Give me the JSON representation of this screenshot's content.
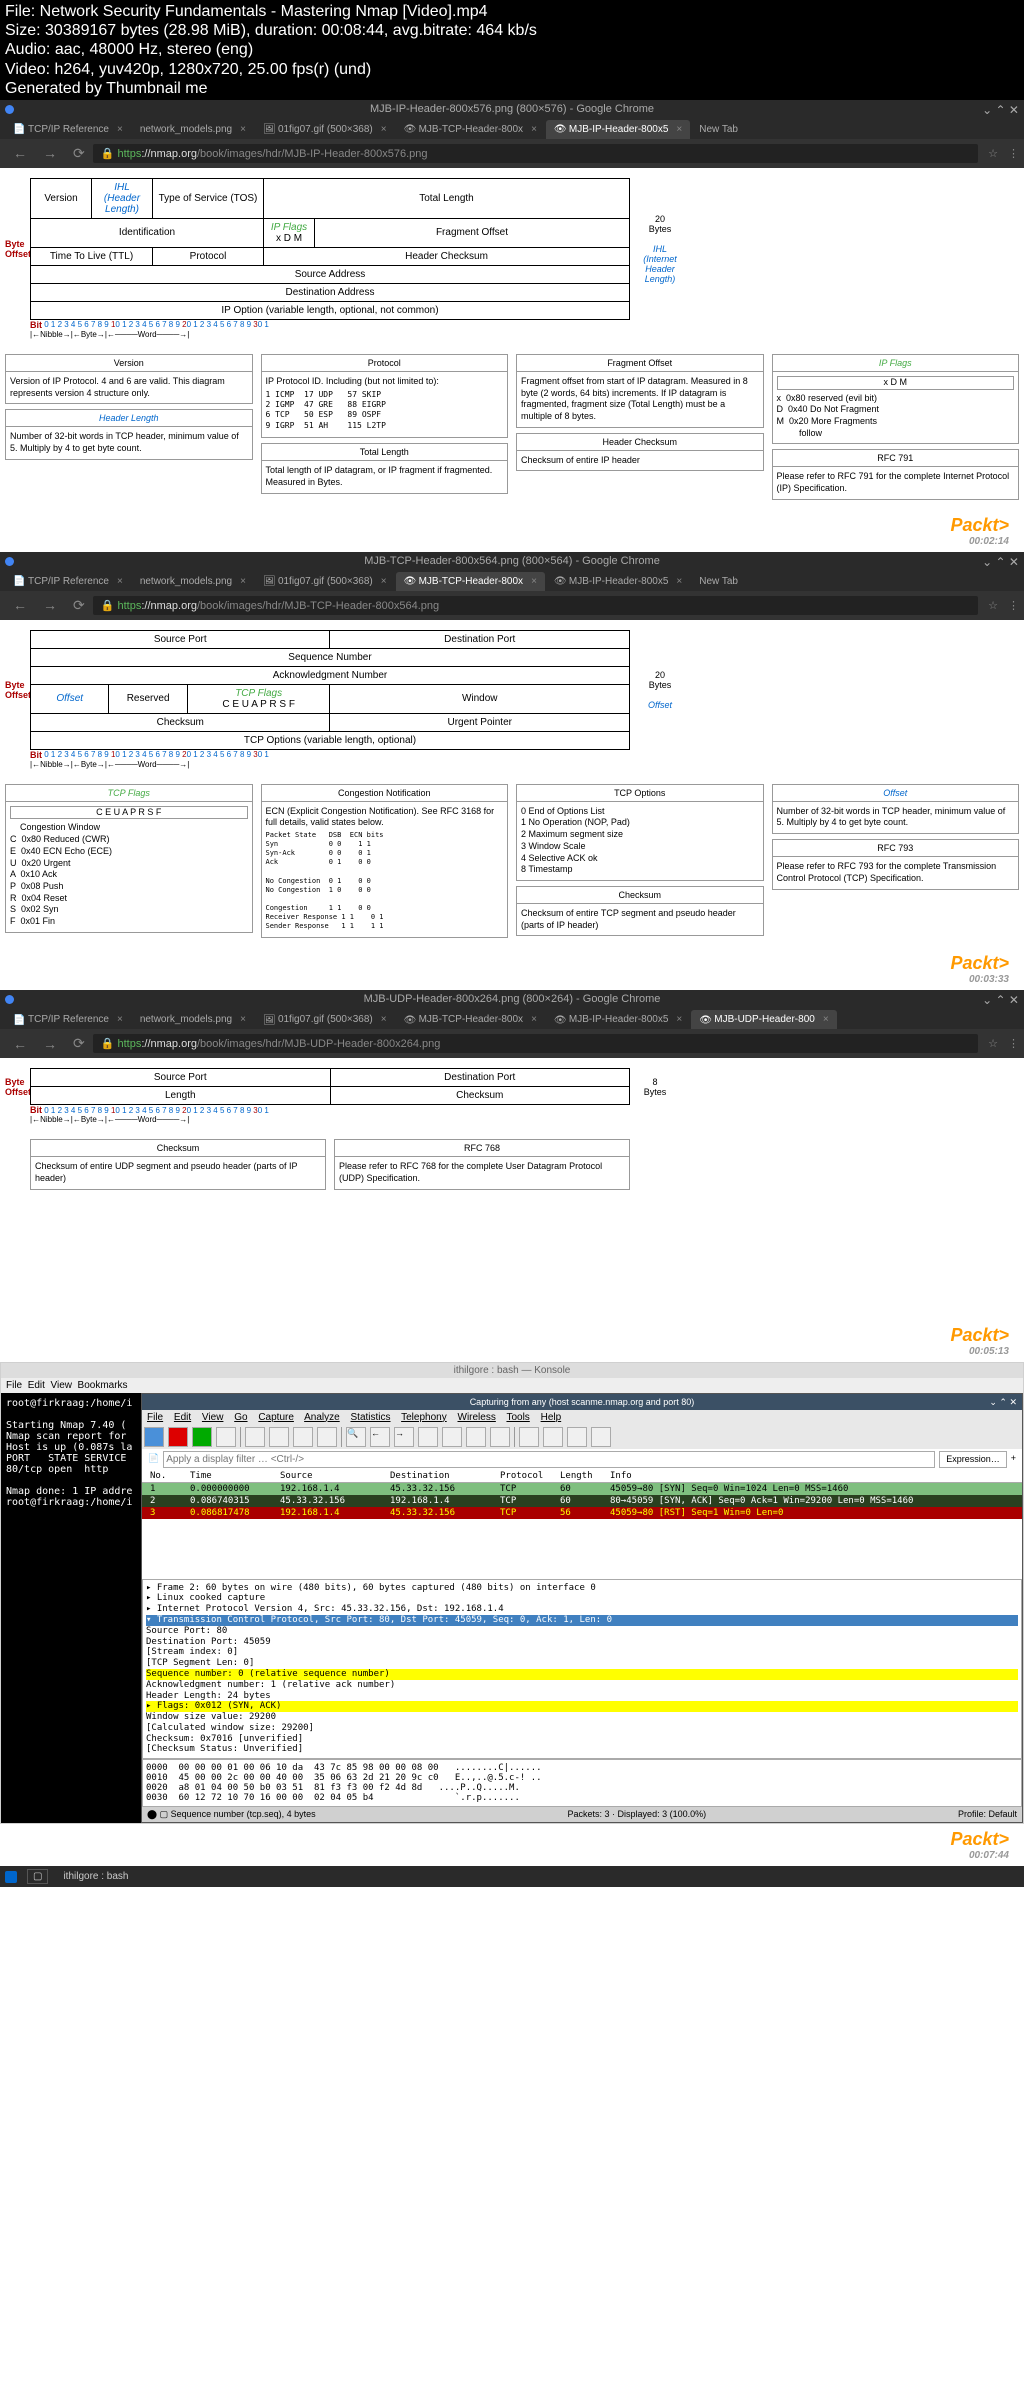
{
  "video_info": {
    "file": "File: Network Security Fundamentals - Mastering Nmap [Video].mp4",
    "size": "Size: 30389167 bytes (28.98 MiB), duration: 00:08:44, avg.bitrate: 464 kb/s",
    "audio": "Audio: aac, 48000 Hz, stereo (eng)",
    "video": "Video: h264, yuv420p, 1280x720, 25.00 fps(r) (und)",
    "generated": "Generated by Thumbnail me"
  },
  "screen1": {
    "title": "MJB-IP-Header-800x576.png (800×576) - Google Chrome",
    "tabs": [
      "TCP/IP Reference",
      "network_models.png",
      "01fig07.gif (500×368)",
      "MJB-TCP-Header-800x",
      "MJB-IP-Header-800x5",
      "New Tab"
    ],
    "active_tab": 4,
    "url_prefix": "https",
    "url_host": "://nmap.org",
    "url_path": "/book/images/hdr/MJB-IP-Header-800x576.png",
    "byte_offset": "Byte\nOffset",
    "row0": {
      "version": "Version",
      "ihl": "IHL (Header Length)",
      "tos": "Type of Service (TOS)",
      "total": "Total Length"
    },
    "row4": {
      "id": "Identification",
      "flags": "IP Flags",
      "flags_bits": "x  D  M",
      "frag": "Fragment Offset"
    },
    "row8": {
      "ttl": "Time To Live (TTL)",
      "proto": "Protocol",
      "chk": "Header Checksum"
    },
    "row12": "Source Address",
    "row16": "Destination Address",
    "row20": "IP Option (variable length, optional, not common)",
    "side_20bytes": "20\nBytes",
    "side_ihl": "IHL\n(Internet\nHeader\nLength)",
    "bit_label": "Bit",
    "nibble": "Nibble",
    "byte": "Byte",
    "word": "Word",
    "boxes": {
      "version": {
        "t": "Version",
        "b": "Version of IP Protocol.  4 and 6 are valid.  This diagram represents version 4 structure only."
      },
      "hlen": {
        "t": "Header Length",
        "b": "Number of 32-bit words in TCP header, minimum value of 5.  Multiply by 4 to get byte count."
      },
      "protocol": {
        "t": "Protocol",
        "b": "IP Protocol ID.  Including (but not limited to):"
      },
      "protocol_table": "1 ICMP  17 UDP   57 SKIP\n2 IGMP  47 GRE   88 EIGRP\n6 TCP   50 ESP   89 OSPF\n9 IGRP  51 AH    115 L2TP",
      "tlen": {
        "t": "Total Length",
        "b": "Total length of IP datagram, or IP fragment if fragmented. Measured in Bytes."
      },
      "frag": {
        "t": "Fragment Offset",
        "b": "Fragment offset from start of IP datagram.  Measured in 8 byte (2 words, 64 bits) increments.  If IP datagram is fragmented, fragment size (Total Length) must be a multiple of 8 bytes."
      },
      "hchk": {
        "t": "Header Checksum",
        "b": "Checksum of entire IP header"
      },
      "ipflags": {
        "t": "IP Flags",
        "bits": "x  D  M",
        "b": "x  0x80 reserved (evil bit)\nD  0x40 Do Not Fragment\nM  0x20 More Fragments\n         follow"
      },
      "rfc": {
        "t": "RFC 791",
        "b": "Please refer to RFC 791 for the complete Internet Protocol (IP) Specification."
      }
    },
    "packt": "Packt>",
    "time": "00:02:14"
  },
  "screen2": {
    "title": "MJB-TCP-Header-800x564.png (800×564) - Google Chrome",
    "tabs": [
      "TCP/IP Reference",
      "network_models.png",
      "01fig07.gif (500×368)",
      "MJB-TCP-Header-800x",
      "MJB-IP-Header-800x5",
      "New Tab"
    ],
    "active_tab": 3,
    "url_path": "/book/images/hdr/MJB-TCP-Header-800x564.png",
    "row0": {
      "src": "Source Port",
      "dst": "Destination Port"
    },
    "row4": "Sequence Number",
    "row8": "Acknowledgment Number",
    "row12": {
      "offset": "Offset",
      "res": "Reserved",
      "flags": "TCP Flags",
      "flags_bits": "C E U A P R S F",
      "win": "Window"
    },
    "row16": {
      "chk": "Checksum",
      "urg": "Urgent Pointer"
    },
    "row20": "TCP Options (variable length, optional)",
    "side_offset": "Offset",
    "boxes": {
      "tcpflags": {
        "t": "TCP Flags",
        "bits": "C E U A P R S F",
        "b": "    Congestion Window\nC  0x80 Reduced (CWR)\nE  0x40 ECN Echo (ECE)\nU  0x20 Urgent\nA  0x10 Ack\nP  0x08 Push\nR  0x04 Reset\nS  0x02 Syn\nF  0x01 Fin"
      },
      "congestion": {
        "t": "Congestion Notification",
        "b": "ECN (Explicit Congestion Notification).  See RFC 3168 for full details, valid states below."
      },
      "congestion_table": "Packet State   DSB  ECN bits\nSyn            0 0    1 1\nSyn-Ack        0 0    0 1\nAck            0 1    0 0\n\nNo Congestion  0 1    0 0\nNo Congestion  1 0    0 0\n\nCongestion     1 1    0 0\nReceiver Response 1 1    0 1\nSender Response   1 1    1 1",
      "tcpopt": {
        "t": "TCP Options",
        "b": "0 End of Options List\n1 No Operation (NOP, Pad)\n2 Maximum segment size\n3 Window Scale\n4 Selective ACK ok\n8 Timestamp"
      },
      "chk": {
        "t": "Checksum",
        "b": "Checksum of entire TCP segment and pseudo header (parts of IP header)"
      },
      "offset": {
        "t": "Offset",
        "b": "Number of 32-bit words in TCP header, minimum value of 5.  Multiply by 4 to get byte count."
      },
      "rfc": {
        "t": "RFC 793",
        "b": "Please refer to RFC 793 for the complete Transmission Control Protocol (TCP) Specification."
      }
    },
    "time": "00:03:33"
  },
  "screen3": {
    "title": "MJB-UDP-Header-800x264.png (800×264) - Google Chrome",
    "tabs": [
      "TCP/IP Reference",
      "network_models.png",
      "01fig07.gif (500×368)",
      "MJB-TCP-Header-800x",
      "MJB-IP-Header-800x5",
      "MJB-UDP-Header-800"
    ],
    "active_tab": 5,
    "url_path": "/book/images/hdr/MJB-UDP-Header-800x264.png",
    "row0": {
      "src": "Source Port",
      "dst": "Destination Port"
    },
    "row4": {
      "len": "Length",
      "chk": "Checksum"
    },
    "side": "8\nBytes",
    "boxes": {
      "chk": {
        "t": "Checksum",
        "b": "Checksum of entire UDP segment and pseudo header (parts of IP header)"
      },
      "rfc": {
        "t": "RFC 768",
        "b": "Please refer to RFC 768 for the complete User Datagram Protocol (UDP) Specification."
      }
    },
    "time": "00:05:13"
  },
  "screen4": {
    "konsole_title": "ithilgore : bash — Konsole",
    "konsole_menu": [
      "File",
      "Edit",
      "View",
      "Bookmarks"
    ],
    "terminal": "root@firkraag:/home/i\n\nStarting Nmap 7.40 (\nNmap scan report for\nHost is up (0.087s la\nPORT   STATE SERVICE\n80/tcp open  http\n\nNmap done: 1 IP addre\nroot@firkraag:/home/i",
    "ws_title": "Capturing from any (host scanme.nmap.org and port 80)",
    "ws_menu": [
      "File",
      "Edit",
      "View",
      "Go",
      "Capture",
      "Analyze",
      "Statistics",
      "Telephony",
      "Wireless",
      "Tools",
      "Help"
    ],
    "ws_filter_placeholder": "Apply a display filter … <Ctrl-/>",
    "ws_expression": "Expression…",
    "ws_headers": [
      "No.",
      "Time",
      "Source",
      "Destination",
      "Protocol",
      "Length",
      "Info"
    ],
    "ws_rows": [
      {
        "no": "1",
        "time": "0.000000000",
        "src": "192.168.1.4",
        "dst": "45.33.32.156",
        "proto": "TCP",
        "len": "60",
        "info": "45059→80 [SYN] Seq=0 Win=1024 Len=0 MSS=1460"
      },
      {
        "no": "2",
        "time": "0.086740315",
        "src": "45.33.32.156",
        "dst": "192.168.1.4",
        "proto": "TCP",
        "len": "60",
        "info": "80→45059 [SYN, ACK] Seq=0 Ack=1 Win=29200 Len=0 MSS=1460"
      },
      {
        "no": "3",
        "time": "0.086817478",
        "src": "192.168.1.4",
        "dst": "45.33.32.156",
        "proto": "TCP",
        "len": "56",
        "info": "45059→80 [RST] Seq=1 Win=0 Len=0"
      }
    ],
    "ws_detail": {
      "l1": "▸ Frame 2: 60 bytes on wire (480 bits), 60 bytes captured (480 bits) on interface 0",
      "l2": "▸ Linux cooked capture",
      "l3": "▸ Internet Protocol Version 4, Src: 45.33.32.156, Dst: 192.168.1.4",
      "l4": "▾ Transmission Control Protocol, Src Port: 80, Dst Port: 45059, Seq: 0, Ack: 1, Len: 0",
      "l5": "    Source Port: 80",
      "l6": "    Destination Port: 45059",
      "l7": "    [Stream index: 0]",
      "l8": "    [TCP Segment Len: 0]",
      "l9": "    Sequence number: 0    (relative sequence number)",
      "l10": "    Acknowledgment number: 1    (relative ack number)",
      "l11": "    Header Length: 24 bytes",
      "l12": "  ▸ Flags: 0x012 (SYN, ACK)",
      "l13": "    Window size value: 29200",
      "l14": "    [Calculated window size: 29200]",
      "l15": "    Checksum: 0x7016 [unverified]",
      "l16": "    [Checksum Status: Unverified]"
    },
    "ws_hex": "0000  00 00 00 01 00 06 10 da  43 7c 85 98 00 00 08 00   ........C|......\n0010  45 00 00 2c 00 00 40 00  35 06 63 2d 21 20 9c c0   E..,..@.5.c-! ..\n0020  a8 01 04 00 50 b0 03 51  81 f3 f3 00 f2 4d 8d   ....P..Q.....M.\n0030  60 12 72 10 70 16 00 00  02 04 05 b4               `.r.p.......",
    "ws_status_left": "⬤  ▢  Sequence number (tcp.seq), 4 bytes",
    "ws_status_mid": "Packets: 3 · Displayed: 3 (100.0%)",
    "ws_status_right": "Profile: Default",
    "taskbar": "ithilgore : bash",
    "time": "00:07:44"
  }
}
